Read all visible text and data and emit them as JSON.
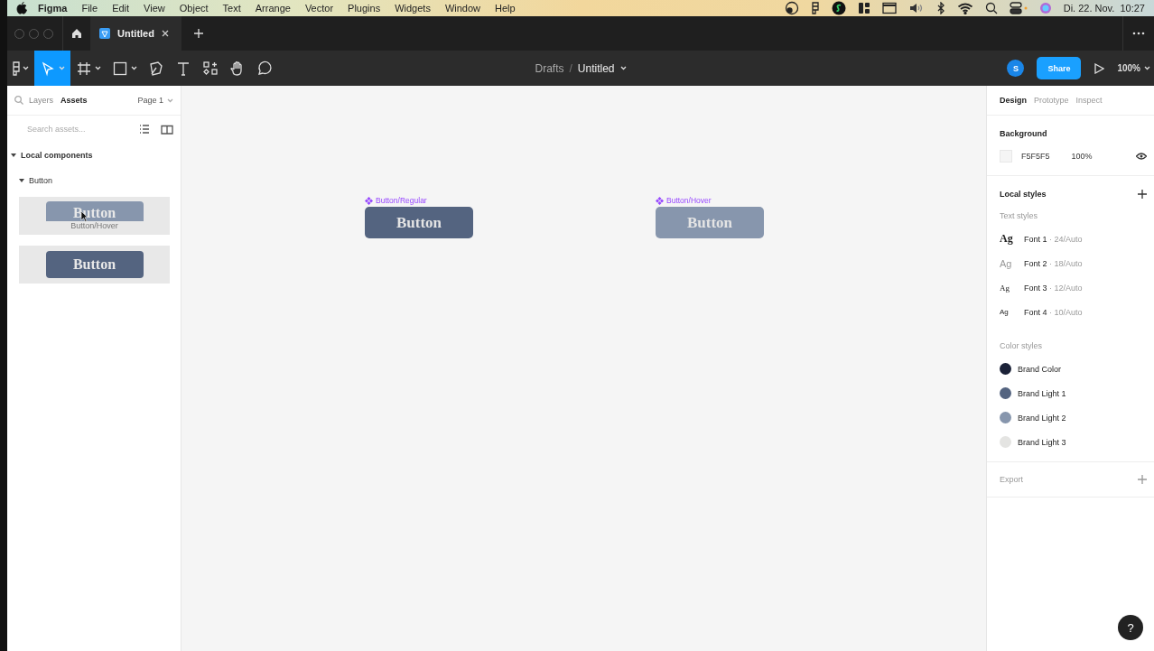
{
  "menu_bar": {
    "app": "Figma",
    "items": [
      "File",
      "Edit",
      "View",
      "Object",
      "Text",
      "Arrange",
      "Vector",
      "Plugins",
      "Widgets",
      "Window",
      "Help"
    ],
    "clock": "Di. 22. Nov.  10:27"
  },
  "tabs": [
    {
      "label": "Untitled",
      "selected": true
    }
  ],
  "toolbar": {
    "tools": [
      {
        "kind": "main",
        "selected": false
      },
      {
        "kind": "move",
        "selected": true
      },
      {
        "kind": "frame",
        "selected": false
      },
      {
        "kind": "shape",
        "selected": false
      },
      {
        "kind": "pen",
        "selected": false
      },
      {
        "kind": "text",
        "selected": false
      },
      {
        "kind": "resources",
        "selected": false
      },
      {
        "kind": "hand",
        "selected": false
      },
      {
        "kind": "comment",
        "selected": false
      }
    ],
    "breadcrumb": {
      "folder": "Drafts",
      "separator": "/",
      "file": "Untitled"
    },
    "avatar": "S",
    "share": "Share",
    "zoom": "100%"
  },
  "left_panel": {
    "tabs": [
      {
        "label": "Layers",
        "selected": false
      },
      {
        "label": "Assets",
        "selected": true
      }
    ],
    "page": "Page 1",
    "search": {
      "placeholder": "Search assets..."
    },
    "tree": [
      {
        "label": "Local components",
        "expanded": true,
        "children": [
          {
            "label": "Button",
            "expanded": true
          }
        ]
      }
    ],
    "components": [
      {
        "label": "Button",
        "kind": "hover",
        "tooltip": "Button/Hover"
      },
      {
        "label": "Button",
        "kind": "regular"
      }
    ]
  },
  "canvas": {
    "components": [
      {
        "name": "Button/Regular",
        "label": "Button",
        "kind": "regular"
      },
      {
        "name": "Button/Hover",
        "label": "Button",
        "kind": "hover"
      }
    ]
  },
  "right_panel": {
    "tabs": [
      {
        "label": "Design",
        "selected": true
      },
      {
        "label": "Prototype",
        "selected": false
      },
      {
        "label": "Inspect",
        "selected": false
      }
    ],
    "background": {
      "title": "Background",
      "color": "#f5f5f5",
      "hex": "F5F5F5",
      "opacity": "100%"
    },
    "local_styles": {
      "title": "Local styles",
      "text_title": "Text styles",
      "text_styles": [
        {
          "sample": "Ag",
          "name": "Font 1",
          "spec": " · 24/Auto",
          "kind": "serif-large"
        },
        {
          "sample": "Ag",
          "name": "Font 2",
          "spec": " · 18/Auto",
          "kind": "sans-light"
        },
        {
          "sample": "Ag",
          "name": "Font 3",
          "spec": " · 12/Auto",
          "kind": "serif-small"
        },
        {
          "sample": "Ag",
          "name": "Font 4",
          "spec": " · 10/Auto",
          "kind": "sans-small"
        }
      ],
      "color_title": "Color styles",
      "color_styles": [
        {
          "name": "Brand Color",
          "color": "#1b2238"
        },
        {
          "name": "Brand Light 1",
          "color": "#546480"
        },
        {
          "name": "Brand Light 2",
          "color": "#8796ad"
        },
        {
          "name": "Brand Light 3",
          "color": "#e4e4e2"
        }
      ]
    },
    "export": "Export"
  },
  "help": "?"
}
